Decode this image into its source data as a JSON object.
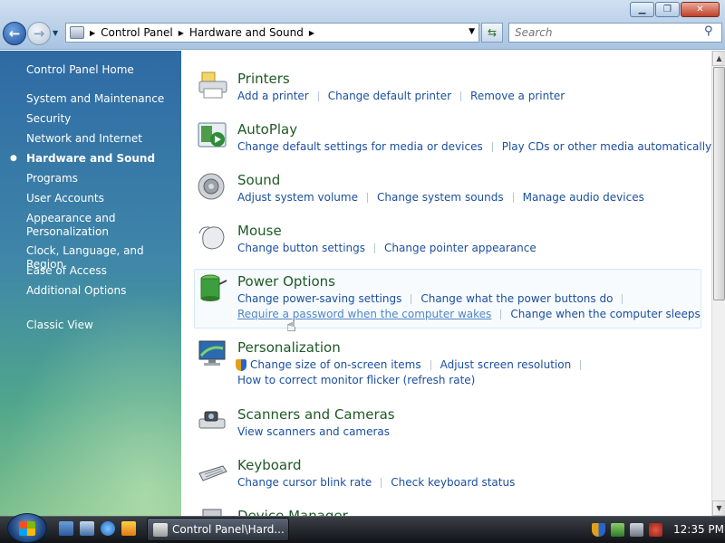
{
  "window": {
    "minimize": "▁",
    "maximize": "❐",
    "close": "✕"
  },
  "address_bar": {
    "segments": [
      "Control Panel",
      "Hardware and Sound"
    ],
    "sep": "▶"
  },
  "search": {
    "placeholder": "Search"
  },
  "sidebar": {
    "items": [
      "Control Panel Home",
      "System and Maintenance",
      "Security",
      "Network and Internet",
      "Hardware and Sound",
      "Programs",
      "User Accounts",
      "Appearance and Personalization",
      "Clock, Language, and Region",
      "Ease of Access",
      "Additional Options",
      "Classic View"
    ],
    "selected": "Hardware and Sound"
  },
  "categories": [
    {
      "title": "Printers",
      "links": [
        "Add a printer",
        "Change default printer",
        "Remove a printer"
      ]
    },
    {
      "title": "AutoPlay",
      "links": [
        "Change default settings for media or devices",
        "Play CDs or other media automatically"
      ]
    },
    {
      "title": "Sound",
      "links": [
        "Adjust system volume",
        "Change system sounds",
        "Manage audio devices"
      ]
    },
    {
      "title": "Mouse",
      "links": [
        "Change button settings",
        "Change pointer appearance"
      ]
    },
    {
      "title": "Power Options",
      "links": [
        "Change power-saving settings",
        "Change what the power buttons do",
        "Require a password when the computer wakes",
        "Change when the computer sleeps"
      ]
    },
    {
      "title": "Personalization",
      "links": [
        "Change size of on-screen items",
        "Adjust screen resolution",
        "How to correct monitor flicker (refresh rate)"
      ]
    },
    {
      "title": "Scanners and Cameras",
      "links": [
        "View scanners and cameras"
      ]
    },
    {
      "title": "Keyboard",
      "links": [
        "Change cursor blink rate",
        "Check keyboard status"
      ]
    },
    {
      "title": "Device Manager",
      "links": []
    }
  ],
  "taskbar": {
    "task_label": "Control Panel\\Hard...",
    "clock": "12:35 PM"
  },
  "colors": {
    "link": "#1c4fa0",
    "category_title": "#1e5a26",
    "sidebar_text": "#ffffff"
  }
}
